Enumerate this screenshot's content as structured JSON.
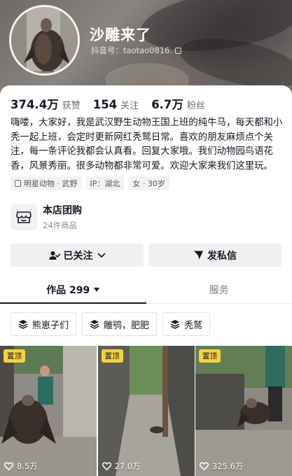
{
  "profile": {
    "nickname": "沙雕来了",
    "douyin_id": "抖音号：taotao0816."
  },
  "stats": [
    {
      "value": "374.4万",
      "label": "获赞"
    },
    {
      "value": "154",
      "label": "关注"
    },
    {
      "value": "6.7万",
      "label": "粉丝"
    }
  ],
  "bio": [
    "嗨喽，大家好，我是武汉野生动物王国上班的纯牛马，每天都和小",
    "秃一起上班，会定时更新网红秃鹫日常。喜欢的朋友麻烦点个关",
    "注，每一条评论我都会认真看。回复大家哦。我们动物园鸟语花",
    "香，风景秀丽。很多动物都非常可爱。欢迎大家来我们这里玩。"
  ],
  "tags": [
    {
      "icon": "verified-org-icon",
      "text": "明星动物 · 武野"
    },
    {
      "icon": "",
      "text": "IP：湖北"
    },
    {
      "icon": "",
      "text": "女 · 30岁"
    }
  ],
  "shop": {
    "title": "本店团购",
    "subtitle": "24件商品",
    "icon": "store-icon"
  },
  "actions": {
    "follow_label": "已关注",
    "message_label": "发私信"
  },
  "tabs": [
    {
      "label": "作品 299",
      "active": true
    },
    {
      "label": "服务",
      "active": false
    }
  ],
  "collections": [
    "熊崽子们",
    "雕鸮，肥肥",
    "秃鹫"
  ],
  "videos": [
    {
      "pinned_label": "置顶",
      "likes": "8.5万"
    },
    {
      "pinned_label": "置顶",
      "likes": "27.0万"
    },
    {
      "pinned_label": "置顶",
      "likes": "325.6万"
    }
  ],
  "colors": {
    "pin_badge": "#f4d23e",
    "text_primary": "#161823",
    "button_bg": "#f0f0f2"
  }
}
